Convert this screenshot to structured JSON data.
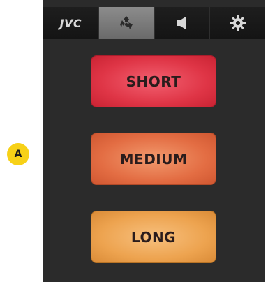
{
  "annotation": {
    "marker_label": "A"
  },
  "tabbar": {
    "tabs": [
      {
        "label": "JVC",
        "icon": "jvc-logo",
        "active": false
      },
      {
        "label": "",
        "icon": "recycle-icon",
        "active": true
      },
      {
        "label": "",
        "icon": "speaker-icon",
        "active": false
      },
      {
        "label": "",
        "icon": "gear-icon",
        "active": false
      }
    ]
  },
  "modes": {
    "short_label": "SHORT",
    "medium_label": "MEDIUM",
    "long_label": "LONG"
  },
  "colors": {
    "background": "#2b2b2b",
    "tabbar": "#141414",
    "active_tab": "#7a7a7a",
    "short": "#df3546",
    "medium": "#e36d43",
    "long": "#eda34f",
    "marker": "#f7d117"
  }
}
